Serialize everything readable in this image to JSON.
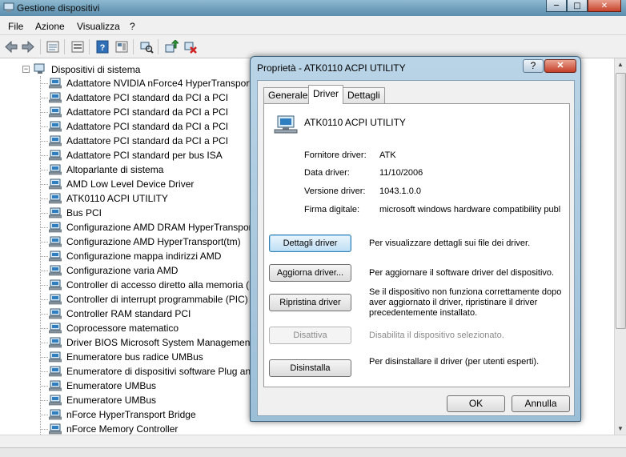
{
  "window": {
    "title": "Gestione dispositivi",
    "minimize": "─",
    "maximize": "□",
    "close": "✕"
  },
  "menu": [
    "File",
    "Azione",
    "Visualizza",
    "?"
  ],
  "tree": {
    "root_expander": "−",
    "root_label": "Dispositivi di sistema",
    "items": [
      "Adattatore NVIDIA nForce4 HyperTransport",
      "Adattatore PCI standard da PCI a PCI",
      "Adattatore PCI standard da PCI a PCI",
      "Adattatore PCI standard da PCI a PCI",
      "Adattatore PCI standard da PCI a PCI",
      "Adattatore PCI standard per bus ISA",
      "Altoparlante di sistema",
      "AMD Low Level Device Driver",
      "ATK0110 ACPI UTILITY",
      "Bus PCI",
      "Configurazione AMD DRAM HyperTransport",
      "Configurazione AMD HyperTransport(tm)",
      "Configurazione mappa indirizzi AMD",
      "Configurazione varia AMD",
      "Controller di accesso diretto alla memoria (DMA)",
      "Controller di interrupt programmabile (PIC)",
      "Controller RAM standard PCI",
      "Coprocessore matematico",
      "Driver BIOS Microsoft System Management",
      "Enumeratore bus radice UMBus",
      "Enumeratore di dispositivi software Plug and Play",
      "Enumeratore UMBus",
      "Enumeratore UMBus",
      "nForce HyperTransport Bridge",
      "nForce Memory Controller"
    ]
  },
  "dialog": {
    "title": "Proprietà - ATK0110 ACPI UTILITY",
    "help_label": "?",
    "close_label": "✕",
    "tabs": [
      "Generale",
      "Driver",
      "Dettagli"
    ],
    "active_tab": "Driver",
    "device_name": "ATK0110 ACPI UTILITY",
    "properties": [
      {
        "label": "Fornitore driver:",
        "value": "ATK"
      },
      {
        "label": "Data driver:",
        "value": "11/10/2006"
      },
      {
        "label": "Versione driver:",
        "value": "1043.1.0.0"
      },
      {
        "label": "Firma digitale:",
        "value": "microsoft windows hardware compatibility publisher"
      }
    ],
    "actions": [
      {
        "button": "Dettagli driver",
        "description": "Per visualizzare dettagli sui file dei driver.",
        "enabled": true,
        "focused": true
      },
      {
        "button": "Aggiorna driver...",
        "description": "Per aggiornare il software driver del dispositivo.",
        "enabled": true,
        "focused": false
      },
      {
        "button": "Ripristina driver",
        "description": "Se il dispositivo non funziona correttamente dopo aver aggiornato il driver, ripristinare il driver precedentemente installato.",
        "enabled": true,
        "focused": false
      },
      {
        "button": "Disattiva",
        "description": "Disabilita il dispositivo selezionato.",
        "enabled": false,
        "focused": false
      },
      {
        "button": "Disinstalla",
        "description": "Per disinstallare il driver (per utenti esperti).",
        "enabled": true,
        "focused": false
      }
    ],
    "ok_label": "OK",
    "cancel_label": "Annulla"
  },
  "icons": {
    "app": "device-manager-icon",
    "device": "system-device-icon",
    "toolbar": [
      "back-icon",
      "forward-icon",
      "properties-icon",
      "list-icon",
      "help-icon",
      "view-icon",
      "scan-hardware-icon",
      "update-driver-icon",
      "uninstall-icon"
    ]
  },
  "colors": {
    "title_bar": "#6f9fbb",
    "dialog_frame": "#9cbfd8",
    "close_button": "#c6422b",
    "disabled_text": "#8a8a8a"
  }
}
